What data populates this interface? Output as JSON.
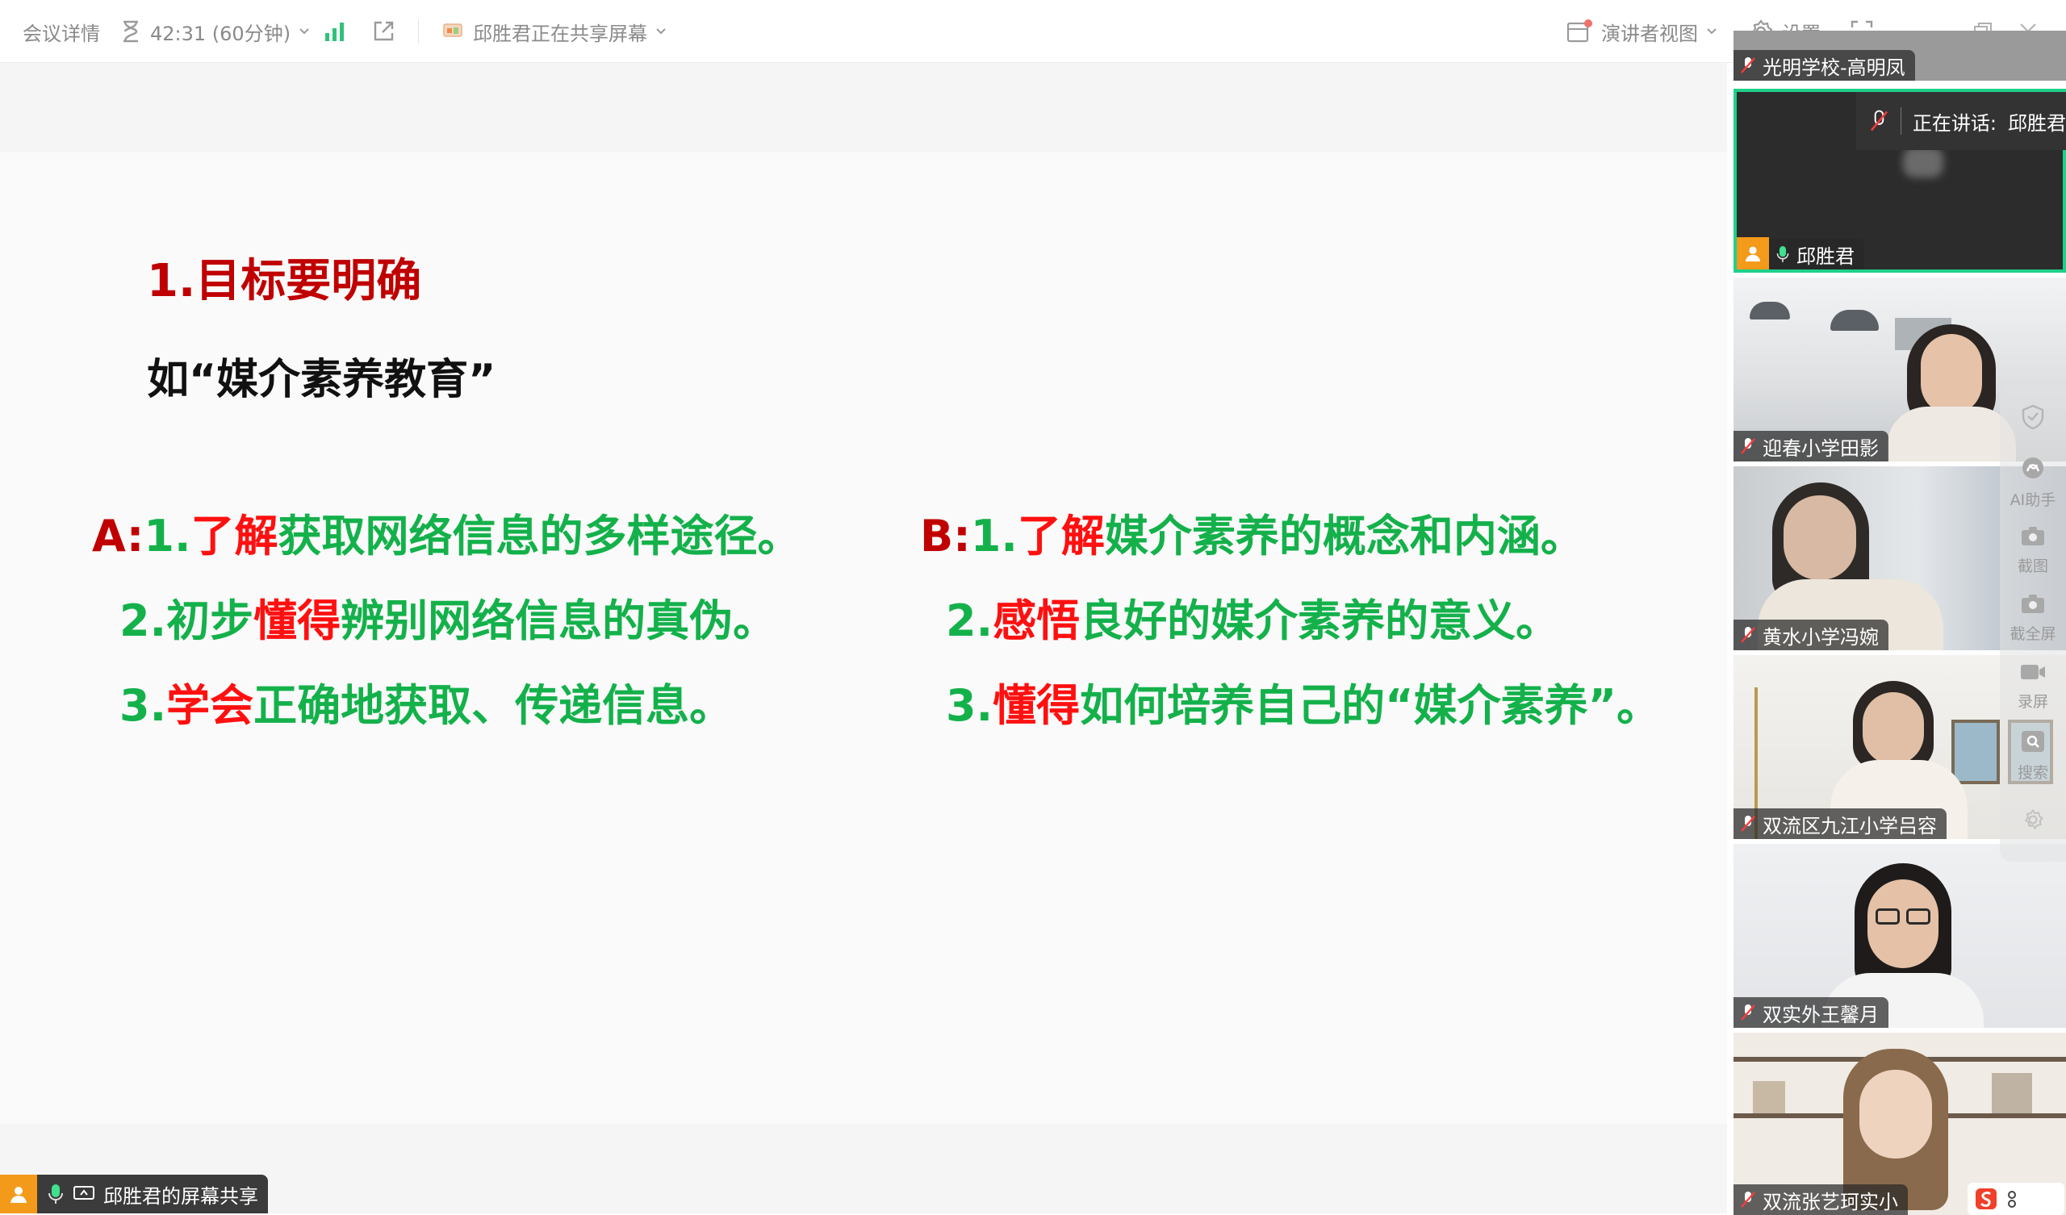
{
  "topbar": {
    "meeting_details": "会议详情",
    "timer": "42:31 (60分钟)",
    "sharing_status": "邱胜君正在共享屏幕",
    "presenter_view": "演讲者视图",
    "settings": "设置"
  },
  "slide": {
    "heading": "1.目标要明确",
    "subheading": "如“媒介素养教育”",
    "a_prefix": "A:",
    "a1": {
      "num": "1.",
      "key": "了解",
      "rest": "获取网络信息的多样途径。"
    },
    "a2": {
      "num": "2.初步",
      "key": "懂得",
      "rest": "辨别网络信息的真伪。"
    },
    "a3": {
      "num": "3.",
      "key": "学会",
      "rest": "正确地获取、传递信息。"
    },
    "b_prefix": "B:",
    "b1": {
      "num": "1.",
      "key": "了解",
      "rest": "媒介素养的概念和内涵。"
    },
    "b2": {
      "num": "2.",
      "key": "感悟",
      "rest": "良好的媒介素养的意义。"
    },
    "b3": {
      "num": "3.",
      "key": "懂得",
      "rest": "如何培养自己的“媒介素养”。"
    }
  },
  "footer": {
    "share_label": "邱胜君的屏幕共享"
  },
  "participants": {
    "top_partial": "光明学校-高明凤",
    "speaking_label": "正在讲话:",
    "speaking_name": "邱胜君",
    "active": "邱胜君",
    "p1": "迎春小学田影",
    "p2": "黄水小学冯婉",
    "p3": "双流区九江小学吕容",
    "p4": "双实外王馨月",
    "p5": "双流张艺珂实小"
  },
  "float_toolbar": {
    "ai": "AI助手",
    "screenshot": "截图",
    "full_screenshot": "截全屏",
    "record": "录屏",
    "search": "搜索"
  },
  "colors": {
    "accent_green": "#1fd08a",
    "title_red": "#c00000",
    "key_red": "#ff1010",
    "text_green": "#14b14b"
  }
}
